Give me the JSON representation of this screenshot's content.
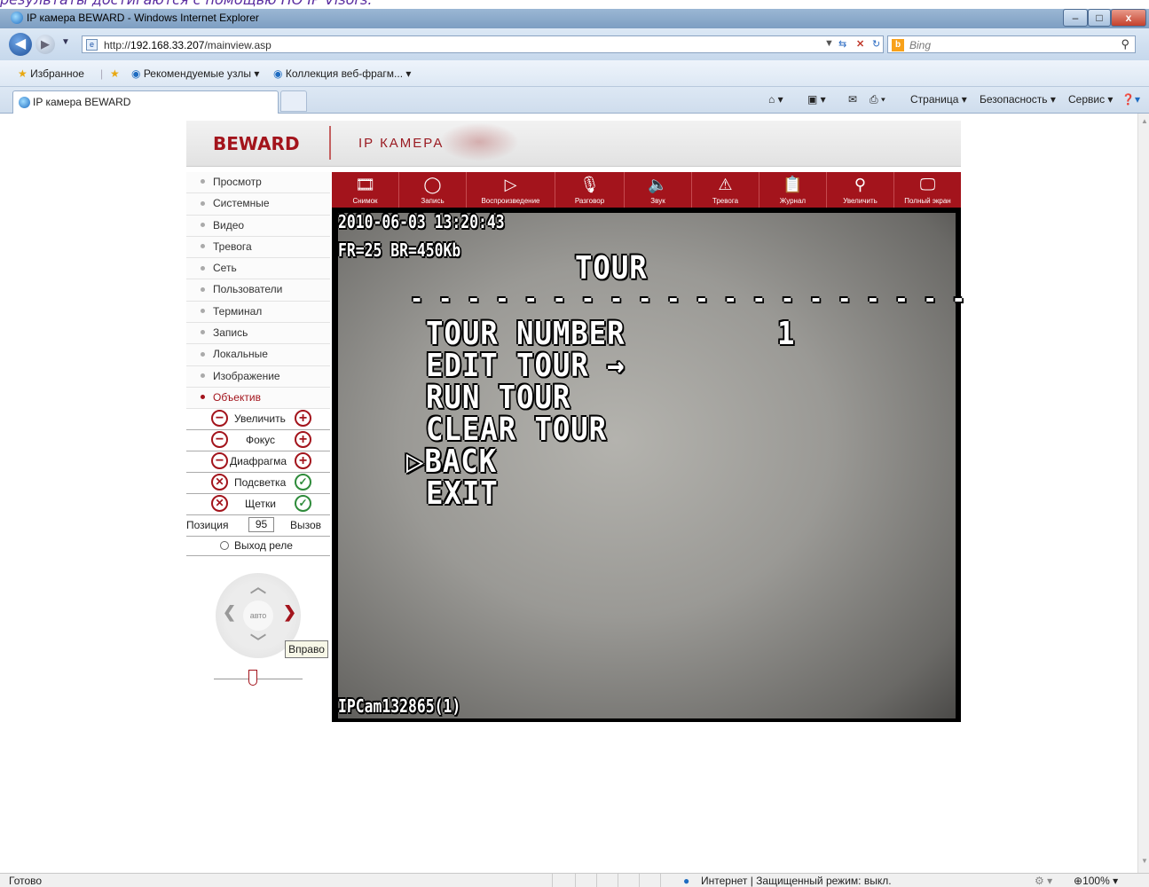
{
  "caption": "результаты достигаются с помощью ПО IP Visors.",
  "window": {
    "title": "IP камера BEWARD - Windows Internet Explorer",
    "minimize": "–",
    "maximize": "□",
    "close": "x"
  },
  "address": {
    "url_prefix": "http://",
    "url_host": "192.168.33.207",
    "url_path": "/mainview.asp",
    "search_placeholder": "Bing"
  },
  "favorites": {
    "label": "Избранное",
    "suggested_sites": "Рекомендуемые узлы ▾",
    "web_slice_gallery": "Коллекция веб-фрагм... ▾"
  },
  "tab": {
    "title": "IP камера BEWARD"
  },
  "command_bar": {
    "page": "Страница ▾",
    "safety": "Безопасность ▾",
    "tools": "Сервис ▾"
  },
  "header": {
    "logo": "BEWARD",
    "subtitle": "IP КАМЕРА"
  },
  "menu": [
    {
      "label": "Просмотр"
    },
    {
      "label": "Системные"
    },
    {
      "label": "Видео"
    },
    {
      "label": "Тревога"
    },
    {
      "label": "Сеть"
    },
    {
      "label": "Пользователи"
    },
    {
      "label": "Терминал"
    },
    {
      "label": "Запись"
    },
    {
      "label": "Локальные"
    },
    {
      "label": "Изображение"
    },
    {
      "label": "Объектив",
      "active": true
    }
  ],
  "lens": {
    "zoom": "Увеличить",
    "focus": "Фокус",
    "iris": "Диафрагма",
    "light": "Подсветка",
    "wipers": "Щетки",
    "position_label": "Позиция",
    "position_value": "95",
    "call": "Вызов",
    "relay": "Выход реле"
  },
  "ptz": {
    "auto": "авто",
    "tooltip": "Вправо",
    "slider_value": 0.5
  },
  "toolbar": [
    {
      "label": "Снимок",
      "icon": "film-icon"
    },
    {
      "label": "Запись",
      "icon": "record-icon"
    },
    {
      "label": "Воспроизведение",
      "icon": "play-icon"
    },
    {
      "label": "Разговор",
      "icon": "microphone-icon"
    },
    {
      "label": "Звук",
      "icon": "speaker-icon"
    },
    {
      "label": "Тревога",
      "icon": "alarm-icon"
    },
    {
      "label": "Журнал",
      "icon": "log-icon"
    },
    {
      "label": "Увеличить",
      "icon": "magnifier-icon"
    },
    {
      "label": "Полный экран",
      "icon": "fullscreen-icon"
    }
  ],
  "video": {
    "timestamp": "2010-06-03 13:20:43",
    "bitrate": "FR=25 BR=450Kb",
    "menu_title": "TOUR",
    "divider": "- - - - - - - - - - - - - - - - - - - -",
    "tour_number_label": "TOUR NUMBER",
    "tour_number_value": "1",
    "edit_tour": "EDIT TOUR →",
    "run_tour": "RUN TOUR",
    "clear_tour": "CLEAR TOUR",
    "back": "▷BACK",
    "exit": "EXIT",
    "camera_name": "IPCam132865(1)"
  },
  "status": {
    "left": "Готово",
    "zone": "Интернет | Защищенный режим: выкл.",
    "zoom": "100%"
  }
}
